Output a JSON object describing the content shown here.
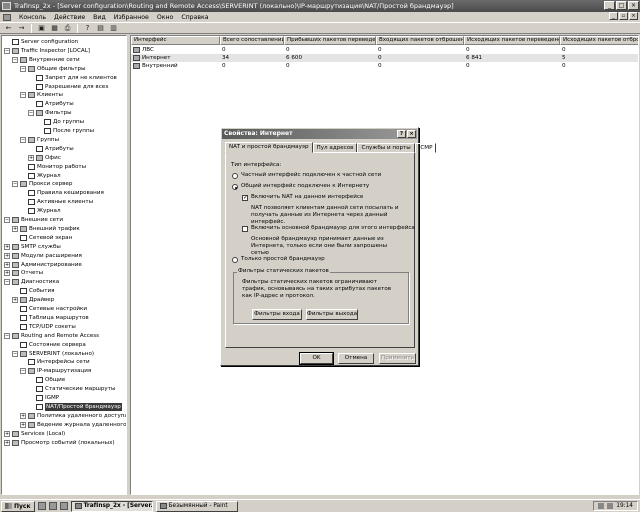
{
  "window": {
    "title": "TrafInsp_2x - [Server configuration\\Routing and Remote Access\\SERVERINT (локально)\\IP-маршрутизация\\NAT/Простой брандмауэр]",
    "min": "_",
    "max": "□",
    "close": "×"
  },
  "menu": [
    "Консоль",
    "Действие",
    "Вид",
    "Избранное",
    "Окно",
    "Справка"
  ],
  "toolbar": [
    "←",
    "→",
    "▣",
    "▦",
    "⎙",
    "?",
    "▤",
    "▥"
  ],
  "tree": [
    {
      "label": "Server configuration",
      "level": 0,
      "exp": "",
      "icon": "doc"
    },
    {
      "label": "Traffic Inspector [LOCAL]",
      "level": 0,
      "exp": "−",
      "icon": "folder"
    },
    {
      "label": "Внутренние сети",
      "level": 1,
      "exp": "−",
      "icon": "folder"
    },
    {
      "label": "Общие фильтры",
      "level": 2,
      "exp": "−",
      "icon": "folder"
    },
    {
      "label": "Запрет для не клиентов",
      "level": 3,
      "exp": "",
      "icon": "doc"
    },
    {
      "label": "Разрешение для всех",
      "level": 3,
      "exp": "",
      "icon": "doc"
    },
    {
      "label": "Клиенты",
      "level": 2,
      "exp": "−",
      "icon": "folder"
    },
    {
      "label": "Атрибуты",
      "level": 3,
      "exp": "",
      "icon": "doc"
    },
    {
      "label": "Фильтры",
      "level": 3,
      "exp": "−",
      "icon": "folder"
    },
    {
      "label": "До группы",
      "level": 4,
      "exp": "",
      "icon": "doc"
    },
    {
      "label": "После группы",
      "level": 4,
      "exp": "",
      "icon": "doc"
    },
    {
      "label": "Группы",
      "level": 2,
      "exp": "−",
      "icon": "folder"
    },
    {
      "label": "Атрибуты",
      "level": 3,
      "exp": "",
      "icon": "doc"
    },
    {
      "label": "Офис",
      "level": 3,
      "exp": "+",
      "icon": "folder"
    },
    {
      "label": "Монитор работы",
      "level": 2,
      "exp": "",
      "icon": "doc"
    },
    {
      "label": "Журнал",
      "level": 2,
      "exp": "",
      "icon": "doc"
    },
    {
      "label": "Прокси сервер",
      "level": 1,
      "exp": "−",
      "icon": "folder"
    },
    {
      "label": "Правила кеширования",
      "level": 2,
      "exp": "",
      "icon": "doc"
    },
    {
      "label": "Активные клиенты",
      "level": 2,
      "exp": "",
      "icon": "doc"
    },
    {
      "label": "Журнал",
      "level": 2,
      "exp": "",
      "icon": "doc"
    },
    {
      "label": "Внешние сети",
      "level": 0,
      "exp": "−",
      "icon": "folder"
    },
    {
      "label": "Внешний трафик",
      "level": 1,
      "exp": "+",
      "icon": "folder"
    },
    {
      "label": "Сетевой экран",
      "level": 1,
      "exp": "",
      "icon": "doc"
    },
    {
      "label": "SMTP службы",
      "level": 0,
      "exp": "+",
      "icon": "folder"
    },
    {
      "label": "Модули расширения",
      "level": 0,
      "exp": "+",
      "icon": "folder"
    },
    {
      "label": "Администрирование",
      "level": 0,
      "exp": "+",
      "icon": "folder"
    },
    {
      "label": "Отчеты",
      "level": 0,
      "exp": "+",
      "icon": "folder"
    },
    {
      "label": "Диагностика",
      "level": 0,
      "exp": "−",
      "icon": "folder"
    },
    {
      "label": "События",
      "level": 1,
      "exp": "",
      "icon": "doc"
    },
    {
      "label": "Драйвер",
      "level": 1,
      "exp": "+",
      "icon": "folder"
    },
    {
      "label": "Сетевые настройки",
      "level": 1,
      "exp": "",
      "icon": "doc"
    },
    {
      "label": "Таблица маршрутов",
      "level": 1,
      "exp": "",
      "icon": "doc"
    },
    {
      "label": "TCP/UDP сокеты",
      "level": 1,
      "exp": "",
      "icon": "doc"
    },
    {
      "label": "Routing and Remote Access",
      "level": 0,
      "exp": "−",
      "icon": "folder"
    },
    {
      "label": "Состояние сервера",
      "level": 1,
      "exp": "",
      "icon": "doc"
    },
    {
      "label": "SERVERINT (локально)",
      "level": 1,
      "exp": "−",
      "icon": "folder"
    },
    {
      "label": "Интерфейсы сети",
      "level": 2,
      "exp": "",
      "icon": "doc"
    },
    {
      "label": "IP-маршрутизация",
      "level": 2,
      "exp": "−",
      "icon": "folder"
    },
    {
      "label": "Общие",
      "level": 3,
      "exp": "",
      "icon": "doc"
    },
    {
      "label": "Статические маршруты",
      "level": 3,
      "exp": "",
      "icon": "doc"
    },
    {
      "label": "IGMP",
      "level": 3,
      "exp": "",
      "icon": "doc"
    },
    {
      "label": "NAT/Простой брандмауэр",
      "level": 3,
      "exp": "",
      "icon": "doc",
      "selected": true
    },
    {
      "label": "Политика удаленного доступа",
      "level": 2,
      "exp": "+",
      "icon": "folder"
    },
    {
      "label": "Ведение журнала удаленного доступа",
      "level": 2,
      "exp": "+",
      "icon": "folder"
    },
    {
      "label": "Services (Local)",
      "level": 0,
      "exp": "+",
      "icon": "folder"
    },
    {
      "label": "Просмотр событий (локальных)",
      "level": 0,
      "exp": "+",
      "icon": "folder"
    }
  ],
  "list": {
    "columns": [
      "Интерфейс",
      "Всего сопоставлений",
      "Прибывших пакетов переведено",
      "Входящих пакетов отброшено",
      "Исходящих пакетов переведено",
      "Исходящих пакетов отбро"
    ],
    "rows": [
      [
        "ЛВС",
        "0",
        "0",
        "0",
        "0",
        "0"
      ],
      [
        "Интернет",
        "34",
        "6 600",
        "0",
        "6 841",
        "5"
      ],
      [
        "Внутренний",
        "0",
        "0",
        "0",
        "0",
        "0"
      ]
    ]
  },
  "dialog": {
    "title": "Свойства: Интернет",
    "help": "?",
    "close": "×",
    "tabs": [
      "NAT и простой брандмауэр",
      "Пул адресов",
      "Службы и порты",
      "ICMP"
    ],
    "type_label": "Тип интерфейса:",
    "opt_private": "Частный интерфейс подключен к частной сети",
    "opt_public": "Общий интерфейс подключен к Интернету",
    "chk_nat": "Включить NAT на данном интерфейсе",
    "nat_desc": "NAT позволяет клиентам данной сети посылать и получать данные из Интернета через данный интерфейс.",
    "chk_fw": "Включить основной брандмауэр для этого интерфейса",
    "fw_desc": "Основной брандмауэр принимает данные из Интернета, только если они были запрошены сетью",
    "opt_fwonly": "Только простой брандмауэр",
    "group_title": "Фильтры статических пакетов",
    "group_desc": "Фильтры статических пакетов ограничивают трафик, основываясь на таких атрибутах пакетов как IP-адрес и протокол.",
    "btn_in": "Фильтры входа",
    "btn_out": "Фильтры выхода",
    "ok": "OK",
    "cancel": "Отмена",
    "apply": "Применить"
  },
  "taskbar": {
    "start": "Пуск",
    "tasks": [
      "TrafInsp_2x - [Server...",
      "Безымянный - Paint"
    ],
    "time": "19:14"
  }
}
